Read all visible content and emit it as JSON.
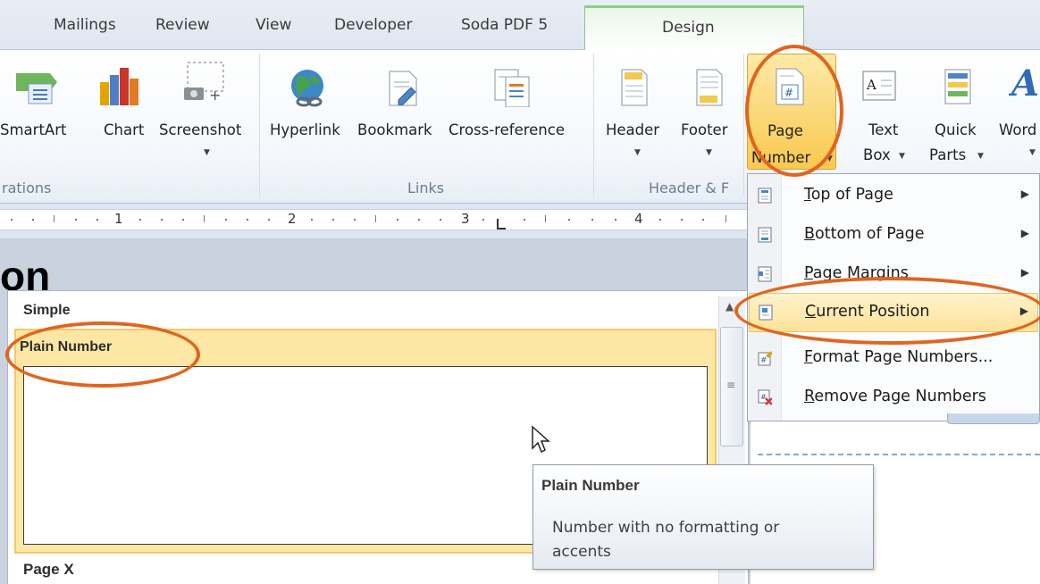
{
  "tabs": [
    {
      "label": "Mailings"
    },
    {
      "label": "Review"
    },
    {
      "label": "View"
    },
    {
      "label": "Developer"
    },
    {
      "label": "Soda PDF 5"
    },
    {
      "label": "Design"
    }
  ],
  "ribbon": {
    "smartart": "SmartArt",
    "chart": "Chart",
    "screenshot": "Screenshot",
    "illustrations_partial": "rations",
    "hyperlink": "Hyperlink",
    "bookmark": "Bookmark",
    "crossref": "Cross-reference",
    "links_group": "Links",
    "header": "Header",
    "footer": "Footer",
    "hf_group": "Header & F",
    "page_number_line1": "Page",
    "page_number_line2": "Number",
    "textbox_line1": "Text",
    "textbox_line2": "Box",
    "quickparts_line1": "Quick",
    "quickparts_line2": "Parts",
    "wordart_partial": "Word"
  },
  "ruler": {
    "marks": [
      "1",
      "2",
      "3",
      "4"
    ]
  },
  "doc": {
    "heading_fragment": "on"
  },
  "gallery": {
    "section_header": "Simple",
    "selected_item": "Plain Number",
    "next_item": "Page X"
  },
  "menu": {
    "items": [
      {
        "label": "Top of Page",
        "accel": "T",
        "rest": "op of Page"
      },
      {
        "label": "Bottom of Page",
        "accel": "B",
        "rest": "ottom of Page"
      },
      {
        "label": "Page Margins",
        "accel": "P",
        "rest": "age Margins"
      },
      {
        "label": "Current Position",
        "accel": "C",
        "rest": "urrent Position"
      },
      {
        "label": "Format Page Numbers...",
        "accel": "F",
        "rest": "ormat Page Numbers..."
      },
      {
        "label": "Remove Page Numbers",
        "accel": "R",
        "rest": "emove Page Numbers"
      }
    ]
  },
  "tooltip": {
    "title": "Plain Number",
    "body": "Number with no formatting or accents"
  },
  "colors": {
    "annotation": "#e0651e",
    "highlight": "#fde29a",
    "design_tab": "#8bd07f"
  }
}
